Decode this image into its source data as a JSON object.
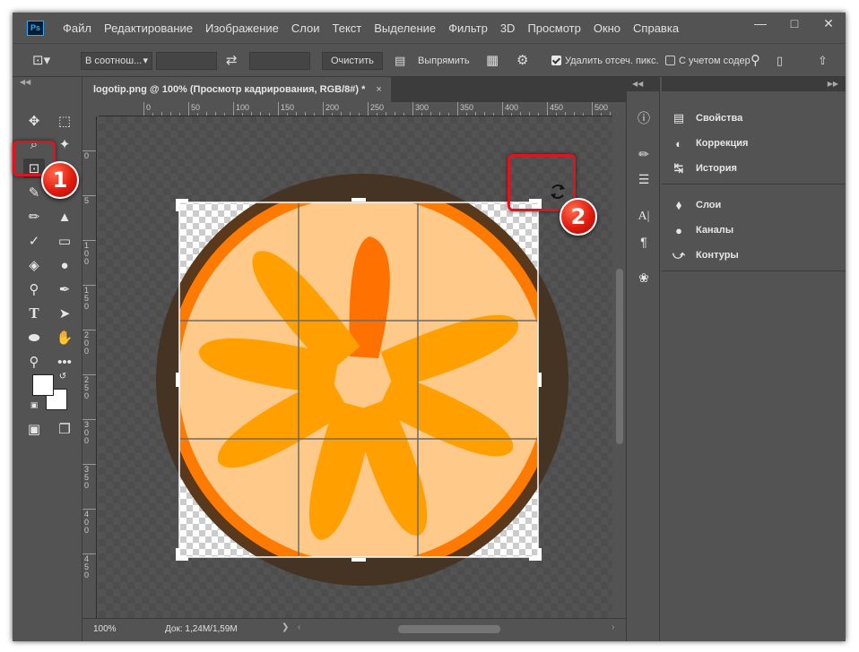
{
  "app": {
    "logo": "Ps",
    "menu": [
      "Файл",
      "Редактирование",
      "Изображение",
      "Слои",
      "Текст",
      "Выделение",
      "Фильтр",
      "3D",
      "Просмотр",
      "Окно",
      "Справка"
    ],
    "window_controls": [
      "minimize-icon",
      "maximize-icon",
      "close-icon"
    ]
  },
  "options": {
    "ratio_dropdown": "В соотнош...",
    "swap_icon": "⇄",
    "clear_button": "Очистить",
    "straighten_label": "Выпрямить",
    "delete_cropped_label": "Удалить отсеч. пикс.",
    "delete_cropped_checked": true,
    "content_aware_label": "С учетом содерж",
    "content_aware_checked": false
  },
  "document": {
    "tab_title": "logotip.png @ 100% (Просмотр кадрирования, RGB/8#) *",
    "tab_close": "×",
    "ruler_h": [
      "0",
      "50",
      "100",
      "150",
      "200",
      "250",
      "300",
      "350",
      "400",
      "450",
      "500"
    ],
    "ruler_v": [
      "0",
      "5",
      "1\n0\n0",
      "1\n5\n0",
      "2\n0\n0",
      "2\n5\n0",
      "3\n0\n0",
      "3\n5\n0",
      "4\n0\n0",
      "4\n5\n0"
    ],
    "zoom": "100%",
    "doc_info": "Док: 1,24M/1,59M"
  },
  "panels": {
    "group1": [
      "Свойства",
      "Коррекция",
      "История"
    ],
    "group2": [
      "Слои",
      "Каналы",
      "Контуры"
    ]
  },
  "annotations": {
    "badge1": "1",
    "badge2": "2"
  },
  "colors": {
    "accent_red": "#e0141e",
    "orange_rim": "#ff7a00",
    "orange_pulp": "#ffa000",
    "peel_light": "#ffc98a",
    "brown_ring": "#5a381c"
  }
}
